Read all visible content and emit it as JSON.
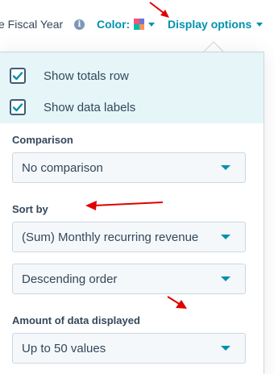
{
  "toolbar": {
    "fiscal_label": "e Fiscal Year",
    "info_icon_glyph": "i",
    "color_label": "Color:",
    "display_options_label": "Display options",
    "swatch_colors": [
      "#f2547d",
      "#6a78d1",
      "#00bda5",
      "#ff8f59"
    ],
    "accent_color": "#0091ae"
  },
  "checkboxes": [
    {
      "label": "Show totals row",
      "checked": true
    },
    {
      "label": "Show data labels",
      "checked": true
    }
  ],
  "comparison": {
    "label": "Comparison",
    "value": "No comparison"
  },
  "sort_by": {
    "label": "Sort by",
    "field_value": "(Sum) Monthly recurring revenue",
    "order_value": "Descending order"
  },
  "amount": {
    "label": "Amount of data displayed",
    "value": "Up to 50 values"
  },
  "annotations": {
    "arrow_color": "#e00000"
  }
}
